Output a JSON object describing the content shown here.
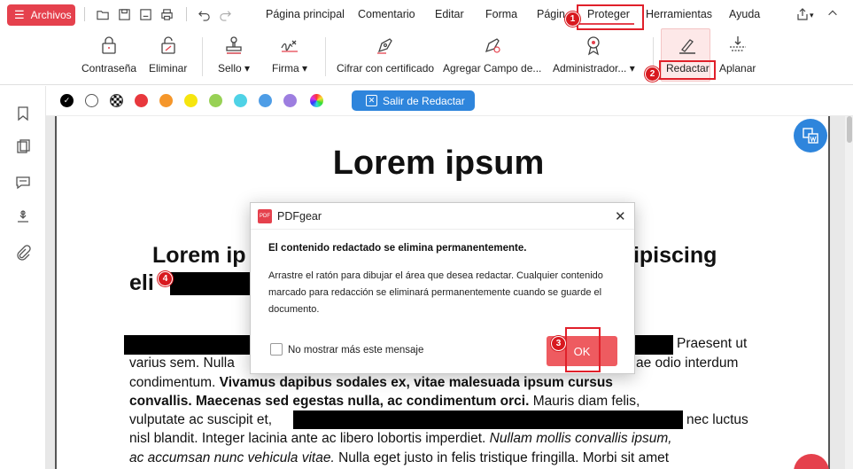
{
  "menubar": {
    "archivos_label": "Archivos",
    "items": [
      "Página principal",
      "Comentario",
      "Editar",
      "Forma",
      "Págin",
      "Proteger",
      "Herramientas",
      "Ayuda"
    ]
  },
  "ribbon": {
    "buttons": [
      {
        "label": "Contraseña",
        "icon": "padlock-icon"
      },
      {
        "label": "Eliminar",
        "icon": "unlock-icon"
      },
      {
        "label": "Sello",
        "icon": "stamp-icon"
      },
      {
        "label": "Firma",
        "icon": "signature-icon"
      },
      {
        "label": "Cifrar con certificado",
        "icon": "cert-pen-icon"
      },
      {
        "label": "Agregar Campo de...",
        "icon": "field-pen-icon"
      },
      {
        "label": "Administrador...",
        "icon": "badge-icon"
      },
      {
        "label": "Redactar",
        "icon": "redact-icon"
      },
      {
        "label": "Aplanar",
        "icon": "flatten-icon"
      }
    ],
    "dropdown_arrow": "▾"
  },
  "colorbar": {
    "colors": [
      "#000000",
      "#ffffff",
      "checker",
      "#e8383d",
      "#f5962a",
      "#f6e50e",
      "#98d155",
      "#4fd2e6",
      "#4e9de6",
      "#9d7ee0",
      "rainbow"
    ],
    "exit_label": "Salir de Redactar"
  },
  "document": {
    "title": "Lorem ipsum",
    "h2_left": "Lorem ip",
    "h2_right": "lipiscing",
    "h2_line2": "eli",
    "line1_end": "Praesent ut",
    "line2_start": "varius sem. Nulla",
    "line2_end": "ae odio interdum",
    "line3_plain": "condimentum. ",
    "line3_bold": "Vivamus dapibus sodales ex, vitae malesuada ipsum cursus",
    "line4_bold": "convallis. Maecenas sed egestas nulla, ac condimentum orci.",
    "line4_plain": " Mauris diam felis,",
    "line5_start": "vulputate ac suscipit et,",
    "line5_end": "nec luctus",
    "line6_plain": "nisl blandit. Integer lacinia ante ac libero lobortis imperdiet. ",
    "line6_italic": "Nullam mollis convallis ipsum,",
    "line7_italic": "ac accumsan nunc vehicula vitae.",
    "line7_plain": " Nulla eget justo in felis tristique fringilla. Morbi sit amet"
  },
  "dialog": {
    "app_name": "PDFgear",
    "logo_text": "PDF",
    "close_glyph": "✕",
    "message": "El contenido redactado se elimina permanentemente.",
    "description": "Arrastre el ratón para dibujar el área que desea redactar. Cualquier contenido marcado para redacción se eliminará permanentemente cuando se guarde el documento.",
    "checkbox_label": "No mostrar más este mensaje",
    "ok_label": "OK"
  },
  "annotations": {
    "badges": [
      "1",
      "2",
      "3",
      "4"
    ]
  }
}
